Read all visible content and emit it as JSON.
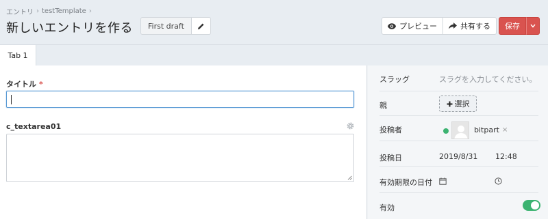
{
  "breadcrumb": {
    "items": [
      "エントリ",
      "testTemplate"
    ]
  },
  "page": {
    "title": "新しいエントリを作る"
  },
  "draft": {
    "label": "First draft"
  },
  "toolbar": {
    "preview_label": "プレビュー",
    "share_label": "共有する",
    "save_label": "保存"
  },
  "tabs": [
    {
      "label": "Tab 1"
    }
  ],
  "form": {
    "title_label": "タイトル",
    "required_mark": "*",
    "title_value": "",
    "textarea_label": "c_textarea01",
    "textarea_value": ""
  },
  "side": {
    "slug_label": "スラッグ",
    "slug_placeholder": "スラグを入力してください。",
    "parent_label": "親",
    "select_label": "選択",
    "author_label": "投稿者",
    "author_name": "bitpart",
    "author_remove": "×",
    "date_label": "投稿日",
    "date_value": "2019/8/31",
    "time_value": "12:48",
    "expiry_label": "有効期限の日付",
    "active_label": "有効",
    "active": true
  },
  "colors": {
    "accent": "#d9534f",
    "focus": "#5b9bd5",
    "online": "#3cb371"
  },
  "icons": {
    "preview": "eye-icon",
    "share": "share-arrow-icon",
    "edit": "pencil-icon",
    "caret": "chevron-down-icon",
    "settings": "gear-icon",
    "plus": "plus-icon",
    "calendar": "calendar-icon",
    "clock": "clock-icon"
  }
}
